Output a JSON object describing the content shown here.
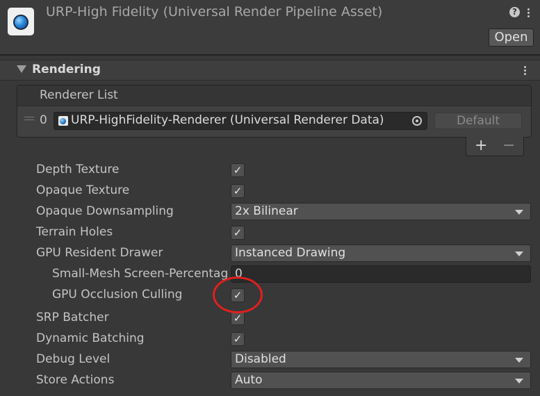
{
  "header": {
    "title": "URP-High Fidelity (Universal Render Pipeline Asset)",
    "help_icon": "question-icon",
    "open_label": "Open"
  },
  "section": {
    "title": "Rendering"
  },
  "renderer_list": {
    "header": "Renderer List",
    "items": [
      {
        "index": "0",
        "value": "URP-HighFidelity-Renderer (Universal Renderer Data)",
        "default_label": "Default"
      }
    ],
    "add_label": "+",
    "remove_label": "−"
  },
  "settings": {
    "depth_texture": {
      "label": "Depth Texture",
      "checked": true
    },
    "opaque_texture": {
      "label": "Opaque Texture",
      "checked": true
    },
    "opaque_downsampling": {
      "label": "Opaque Downsampling",
      "value": "2x Bilinear"
    },
    "terrain_holes": {
      "label": "Terrain Holes",
      "checked": true
    },
    "gpu_resident_drawer": {
      "label": "GPU Resident Drawer",
      "value": "Instanced Drawing"
    },
    "small_mesh": {
      "label": "Small-Mesh Screen-Percentage",
      "value": "0"
    },
    "gpu_occlusion_culling": {
      "label": "GPU Occlusion Culling",
      "checked": true
    },
    "srp_batcher": {
      "label": "SRP Batcher",
      "checked": true
    },
    "dynamic_batching": {
      "label": "Dynamic Batching",
      "checked": true
    },
    "debug_level": {
      "label": "Debug Level",
      "value": "Disabled"
    },
    "store_actions": {
      "label": "Store Actions",
      "value": "Auto"
    }
  },
  "check_glyph": "✓",
  "colors": {
    "annotation": "#e0201e",
    "background": "#383838"
  }
}
